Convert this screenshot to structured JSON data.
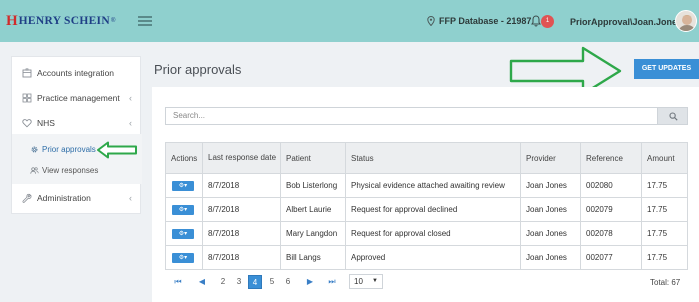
{
  "header": {
    "logo_text": "HENRY SCHEIN",
    "logo_reg": "®",
    "database": "FFP Database - 21987",
    "notification_count": "1",
    "user": "PriorApproval\\Joan.Jones"
  },
  "sidebar": {
    "items": [
      {
        "label": "Accounts integration",
        "icon": "building-icon"
      },
      {
        "label": "Practice management",
        "icon": "grid-icon"
      },
      {
        "label": "NHS",
        "icon": "heart-icon"
      },
      {
        "label": "Administration",
        "icon": "wrench-icon"
      }
    ],
    "sub_items": [
      {
        "label": "Prior approvals",
        "icon": "gear-icon"
      },
      {
        "label": "View responses",
        "icon": "users-icon"
      }
    ]
  },
  "main": {
    "title": "Prior approvals",
    "get_updates_label": "GET UPDATES",
    "search_placeholder": "Search...",
    "columns": [
      "Actions",
      "Last response date",
      "Patient",
      "Status",
      "Provider",
      "Reference",
      "Amount"
    ],
    "rows": [
      {
        "date": "8/7/2018",
        "patient": "Bob Listerlong",
        "status": "Physical evidence attached awaiting review",
        "provider": "Joan Jones",
        "reference": "002080",
        "amount": "17.75"
      },
      {
        "date": "8/7/2018",
        "patient": "Albert Laurie",
        "status": "Request for approval declined",
        "provider": "Joan Jones",
        "reference": "002079",
        "amount": "17.75"
      },
      {
        "date": "8/7/2018",
        "patient": "Mary Langdon",
        "status": "Request for approval closed",
        "provider": "Joan Jones",
        "reference": "002078",
        "amount": "17.75"
      },
      {
        "date": "8/7/2018",
        "patient": "Bill Langs",
        "status": "Approved",
        "provider": "Joan Jones",
        "reference": "002077",
        "amount": "17.75"
      }
    ],
    "pagination": {
      "pages": [
        "2",
        "3",
        "4",
        "5",
        "6"
      ],
      "active_page": "4",
      "page_size": "10",
      "total": "Total: 67"
    }
  },
  "colors": {
    "topbar": "#8fd0ce",
    "accent": "#3a8fd6",
    "annotation_arrow": "#2ea84a",
    "badge": "#e05353"
  }
}
